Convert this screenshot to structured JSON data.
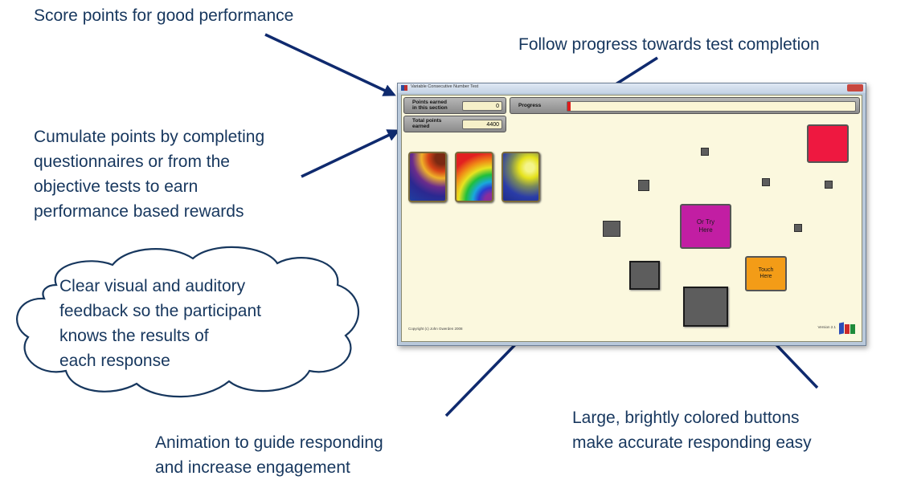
{
  "annotations": {
    "score_points": "Score points for good performance",
    "follow_progress": "Follow progress towards test completion",
    "cumulate_points": "Cumulate points by completing\nquestionnaires or from the\nobjective tests to earn\nperformance based rewards",
    "feedback": "Clear visual and auditory\nfeedback so the participant\nknows the results of\neach response",
    "animation": "Animation to guide responding\nand increase engagement",
    "large_buttons": "Large, brightly colored buttons\nmake accurate responding easy"
  },
  "window": {
    "title": "Variable Consecutive Number Test"
  },
  "points": {
    "section_label": "Points earned\nin this section",
    "section_value": "0",
    "total_label": "Total points\nearned",
    "total_value": "4400"
  },
  "progress": {
    "label": "Progress",
    "fraction": 0.01
  },
  "buttons": {
    "or_try_here": "Or Try\nHere",
    "touch_here": "Touch\nHere"
  },
  "footer": {
    "copyright": "Copyright (c) John Gwerden 2008",
    "version": "Version 2.1"
  },
  "colors": {
    "annotation_text": "#17375e",
    "arrow": "#0f2a6e",
    "cloud_border": "#17375e",
    "window_background": "#fbf8de",
    "magenta_button": "#c21ea3",
    "orange_button": "#f39c17",
    "red_button": "#ee1840",
    "progress_fill": "#e01b1b"
  },
  "icons": [
    "app-icon",
    "close-icon",
    "reward-card-icon",
    "logo-icon"
  ]
}
